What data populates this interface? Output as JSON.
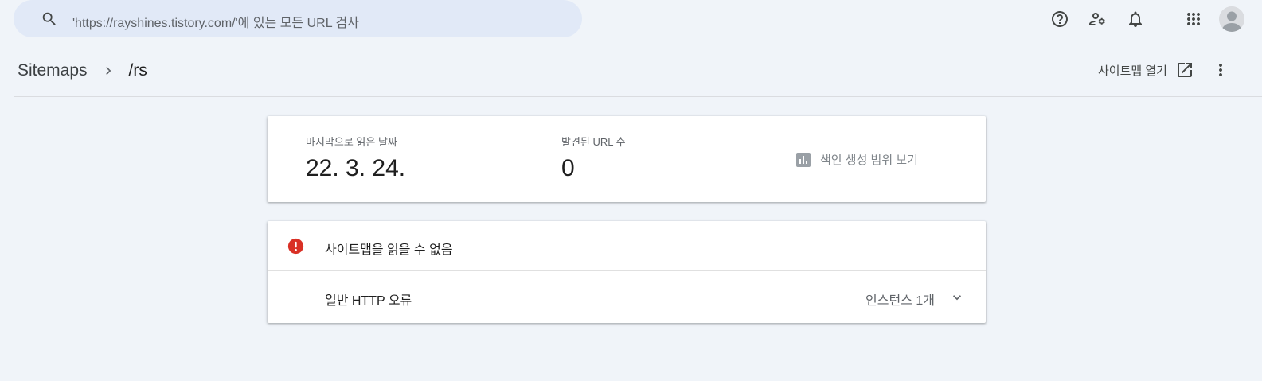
{
  "search": {
    "placeholder": "'https://rayshines.tistory.com/'에 있는 모든 URL 검사",
    "icon": "search-icon"
  },
  "topbar": {
    "icons": [
      "help-icon",
      "manage-users-icon",
      "notifications-icon",
      "apps-icon",
      "avatar"
    ]
  },
  "header": {
    "breadcrumb_root": "Sitemaps",
    "breadcrumb_current": "/rs",
    "open_sitemap_label": "사이트맵 열기"
  },
  "stats": {
    "last_read_label": "마지막으로 읽은 날짜",
    "last_read_value": "22. 3. 24.",
    "discovered_label": "발견된 URL 수",
    "discovered_value": "0",
    "coverage_link": "색인 생성 범위 보기"
  },
  "errors": {
    "title": "사이트맵을 읽을 수 없음",
    "rows": [
      {
        "name": "일반 HTTP 오류",
        "count": "인스턴스 1개"
      }
    ]
  },
  "colors": {
    "background": "#f0f4f9",
    "search_bg": "#e1e9f7",
    "error_red": "#d93025",
    "icon_gray": "#5f6368"
  }
}
